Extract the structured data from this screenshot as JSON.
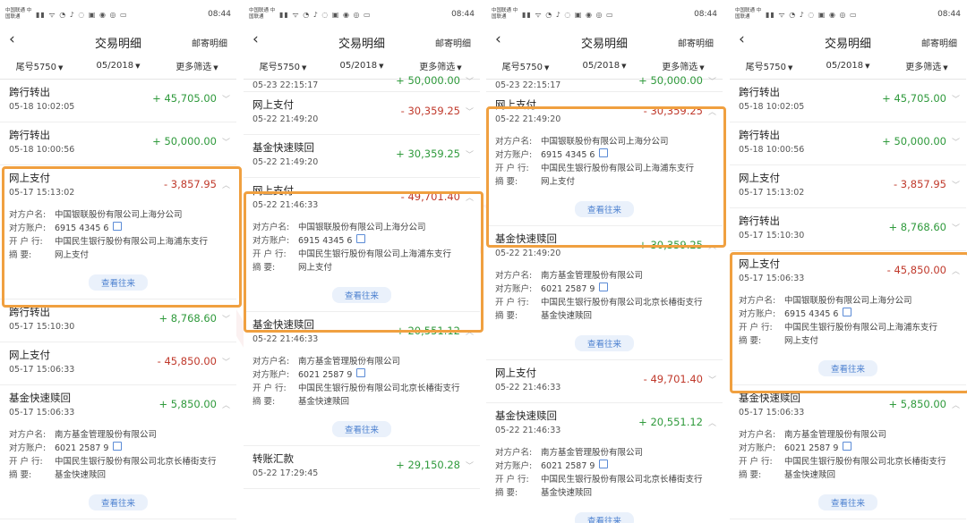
{
  "status": {
    "carrier": "中国联通\n中国联通",
    "icons": "▮▮ ᯤ ◔ ♪ ◌ ▣ ◉ ◎ ▭",
    "time": "08:44"
  },
  "nav": {
    "title": "交易明细",
    "right": "邮寄明细"
  },
  "filters": [
    "尾号5750",
    "05/2018",
    "更多筛选"
  ],
  "labels": {
    "counterparty": "对方户名:",
    "account": "对方账户:",
    "bank": "开 户 行:",
    "memo": "摘    要:",
    "view": "查看往来"
  },
  "phones": [
    {
      "rows": [
        {
          "title": "跨行转出",
          "date": "05-18 10:02:05",
          "amount": "+ 45,705.00",
          "sign": "pos"
        },
        {
          "title": "跨行转出",
          "date": "05-18 10:00:56",
          "amount": "+ 50,000.00",
          "sign": "pos"
        },
        {
          "title": "网上支付",
          "date": "05-17 15:13:02",
          "amount": "- 3,857.95",
          "sign": "neg",
          "expanded": true,
          "detail": {
            "counterparty": "中国银联股份有限公司上海分公司",
            "account": "6915 4345 6",
            "bank": "中国民生银行股份有限公司上海浦东支行",
            "memo": "网上支付"
          }
        },
        {
          "title": "跨行转出",
          "date": "05-17 15:10:30",
          "amount": "+ 8,768.60",
          "sign": "pos"
        },
        {
          "title": "网上支付",
          "date": "05-17 15:06:33",
          "amount": "- 45,850.00",
          "sign": "neg"
        },
        {
          "title": "基金快速赎回",
          "date": "05-17 15:06:33",
          "amount": "+ 5,850.00",
          "sign": "pos",
          "expanded": true,
          "detail": {
            "counterparty": "南方基金管理股份有限公司",
            "account": "6021 2587 9",
            "bank": "中国民生银行股份有限公司北京长椿街支行",
            "memo": "基金快速赎回"
          }
        }
      ]
    },
    {
      "rows": [
        {
          "title": "",
          "date": "05-23 22:15:17",
          "amount": "+ 50,000.00",
          "sign": "pos",
          "partial": true
        },
        {
          "title": "网上支付",
          "date": "05-22 21:49:20",
          "amount": "- 30,359.25",
          "sign": "neg"
        },
        {
          "title": "基金快速赎回",
          "date": "05-22 21:49:20",
          "amount": "+ 30,359.25",
          "sign": "pos"
        },
        {
          "title": "网上支付",
          "date": "05-22 21:46:33",
          "amount": "- 49,701.40",
          "sign": "neg",
          "expanded": true,
          "detail": {
            "counterparty": "中国银联股份有限公司上海分公司",
            "account": "6915 4345 6",
            "bank": "中国民生银行股份有限公司上海浦东支行",
            "memo": "网上支付"
          }
        },
        {
          "title": "基金快速赎回",
          "date": "05-22 21:46:33",
          "amount": "+ 20,551.12",
          "sign": "pos",
          "expanded": true,
          "detail": {
            "counterparty": "南方基金管理股份有限公司",
            "account": "6021 2587 9",
            "bank": "中国民生银行股份有限公司北京长椿街支行",
            "memo": "基金快速赎回"
          }
        },
        {
          "title": "转账汇款",
          "date": "05-22 17:29:45",
          "amount": "+ 29,150.28",
          "sign": "pos"
        }
      ]
    },
    {
      "rows": [
        {
          "title": "",
          "date": "05-23 22:15:17",
          "amount": "+ 50,000.00",
          "sign": "pos",
          "partial": true
        },
        {
          "title": "网上支付",
          "date": "05-22 21:49:20",
          "amount": "- 30,359.25",
          "sign": "neg",
          "expanded": true,
          "detail": {
            "counterparty": "中国银联股份有限公司上海分公司",
            "account": "6915 4345 6",
            "bank": "中国民生银行股份有限公司上海浦东支行",
            "memo": "网上支付"
          }
        },
        {
          "title": "基金快速赎回",
          "date": "05-22 21:49:20",
          "amount": "+ 30,359.25",
          "sign": "pos",
          "expanded": true,
          "detail": {
            "counterparty": "南方基金管理股份有限公司",
            "account": "6021 2587 9",
            "bank": "中国民生银行股份有限公司北京长椿街支行",
            "memo": "基金快速赎回"
          }
        },
        {
          "title": "网上支付",
          "date": "05-22 21:46:33",
          "amount": "- 49,701.40",
          "sign": "neg"
        },
        {
          "title": "基金快速赎回",
          "date": "05-22 21:46:33",
          "amount": "+ 20,551.12",
          "sign": "pos",
          "expanded": true,
          "detail": {
            "counterparty": "南方基金管理股份有限公司",
            "account": "6021 2587 9",
            "bank": "中国民生银行股份有限公司北京长椿街支行",
            "memo": "基金快速赎回"
          }
        }
      ]
    },
    {
      "rows": [
        {
          "title": "跨行转出",
          "date": "05-18 10:02:05",
          "amount": "+ 45,705.00",
          "sign": "pos"
        },
        {
          "title": "跨行转出",
          "date": "05-18 10:00:56",
          "amount": "+ 50,000.00",
          "sign": "pos"
        },
        {
          "title": "网上支付",
          "date": "05-17 15:13:02",
          "amount": "- 3,857.95",
          "sign": "neg"
        },
        {
          "title": "跨行转出",
          "date": "05-17 15:10:30",
          "amount": "+ 8,768.60",
          "sign": "pos"
        },
        {
          "title": "网上支付",
          "date": "05-17 15:06:33",
          "amount": "- 45,850.00",
          "sign": "neg",
          "expanded": true,
          "detail": {
            "counterparty": "中国银联股份有限公司上海分公司",
            "account": "6915 4345 6",
            "bank": "中国民生银行股份有限公司上海浦东支行",
            "memo": "网上支付"
          }
        },
        {
          "title": "基金快速赎回",
          "date": "05-17 15:06:33",
          "amount": "+ 5,850.00",
          "sign": "pos",
          "expanded": true,
          "detail": {
            "counterparty": "南方基金管理股份有限公司",
            "account": "6021 2587 9",
            "bank": "中国民生银行股份有限公司北京长椿街支行",
            "memo": "基金快速赎回"
          }
        }
      ]
    }
  ]
}
